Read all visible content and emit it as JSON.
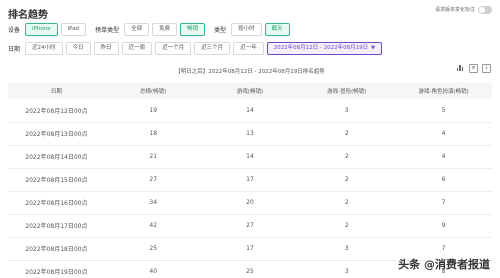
{
  "header": {
    "title": "排名趋势",
    "toggle_label": "请求版本变化标注"
  },
  "filters": {
    "device_label": "设备",
    "devices": [
      "iPhone",
      "iPad"
    ],
    "list_type_label": "榜单类型",
    "list_types": [
      "全部",
      "免费",
      "畅销"
    ],
    "type_label": "类型",
    "types": [
      "按小时",
      "截天"
    ],
    "date_label": "日期",
    "dates": [
      "近24小时",
      "今日",
      "昨日",
      "近一周",
      "近一个月",
      "近三个月",
      "近一年"
    ],
    "date_range": "2022年08月12日 - 2022年08月19日"
  },
  "subtitle": "【明日之后】2022年08月12日 - 2022年08月19日排名趋势",
  "table": {
    "headers": [
      "日期",
      "总榜(畅销)",
      "游戏(畅销)",
      "游戏-冒险(畅销)",
      "游戏-角色扮演(畅销)"
    ],
    "rows": [
      [
        "2022年08月12日00点",
        "19",
        "14",
        "3",
        "5"
      ],
      [
        "2022年08月13日00点",
        "18",
        "13",
        "2",
        "4"
      ],
      [
        "2022年08月14日00点",
        "21",
        "14",
        "2",
        "4"
      ],
      [
        "2022年08月15日00点",
        "27",
        "17",
        "2",
        "6"
      ],
      [
        "2022年08月16日00点",
        "34",
        "20",
        "2",
        "7"
      ],
      [
        "2022年08月17日00点",
        "42",
        "27",
        "2",
        "9"
      ],
      [
        "2022年08月18日00点",
        "25",
        "17",
        "3",
        "7"
      ],
      [
        "2022年08月19日00点",
        "40",
        "25",
        "3",
        "8"
      ]
    ]
  },
  "watermark": "头条 @消费者报道",
  "colors": {
    "active": "#39b88c",
    "date_range": "#6a4cc8"
  }
}
